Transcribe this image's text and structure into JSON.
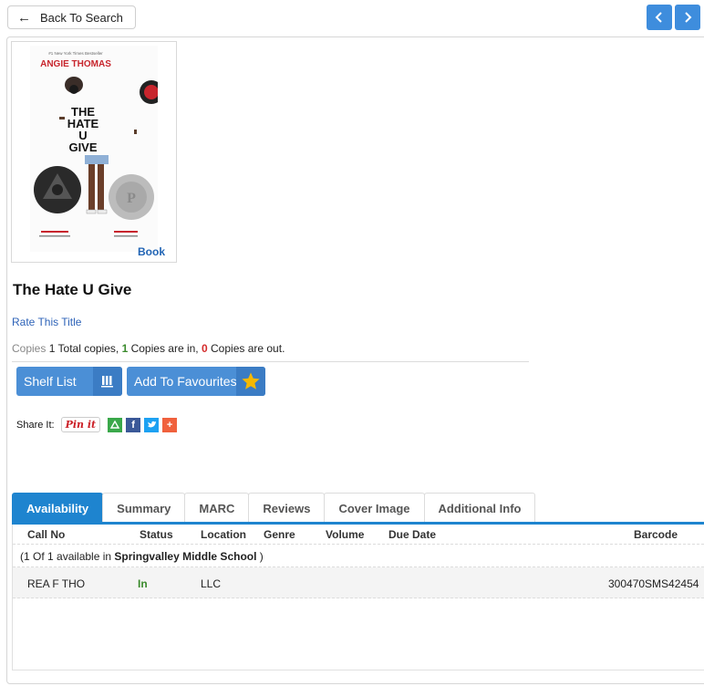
{
  "nav": {
    "back_label": "Back To Search",
    "back_icon": "arrow-left",
    "prev_icon": "chevron-left",
    "next_icon": "chevron-right"
  },
  "book": {
    "title": "The Hate U Give",
    "type_label": "Book",
    "cover": {
      "author": "ANGIE THOMAS",
      "tagline": "#1 New York Times Bestseller",
      "title_lines": [
        "THE",
        "HATE",
        "U",
        "GIVE"
      ]
    }
  },
  "rate_label": "Rate This Title",
  "copies": {
    "label": "Copies",
    "total": "1",
    "total_text": "Total copies,",
    "in": "1",
    "in_text": "Copies are in,",
    "out": "0",
    "out_text": "Copies are out."
  },
  "actions": {
    "shelf_list": "Shelf List",
    "add_favourites": "Add To Favourites"
  },
  "share": {
    "label": "Share It:",
    "pinit": "Pin it",
    "google_icon": "google-drive",
    "facebook_icon": "facebook",
    "twitter_icon": "twitter",
    "more_icon": "plus"
  },
  "colors": {
    "accent": "#1e84cf",
    "button": "#4b8fd6",
    "in_green": "#3a8a2c",
    "out_red": "#d42b2b",
    "star": "#f5b800"
  },
  "tabs": [
    "Availability",
    "Summary",
    "MARC",
    "Reviews",
    "Cover Image",
    "Additional Info"
  ],
  "active_tab": "Availability",
  "table": {
    "headers": {
      "call_no": "Call No",
      "status": "Status",
      "location": "Location",
      "genre": "Genre",
      "volume": "Volume",
      "due_date": "Due Date",
      "barcode": "Barcode"
    },
    "group": {
      "prefix": "(1 Of 1 available in",
      "school": "Springvalley Middle School",
      "suffix": ")"
    },
    "rows": [
      {
        "call_no": "REA F THO",
        "status": "In",
        "location": "LLC",
        "genre": "",
        "volume": "",
        "due_date": "",
        "barcode": "300470SMS42454"
      }
    ]
  }
}
